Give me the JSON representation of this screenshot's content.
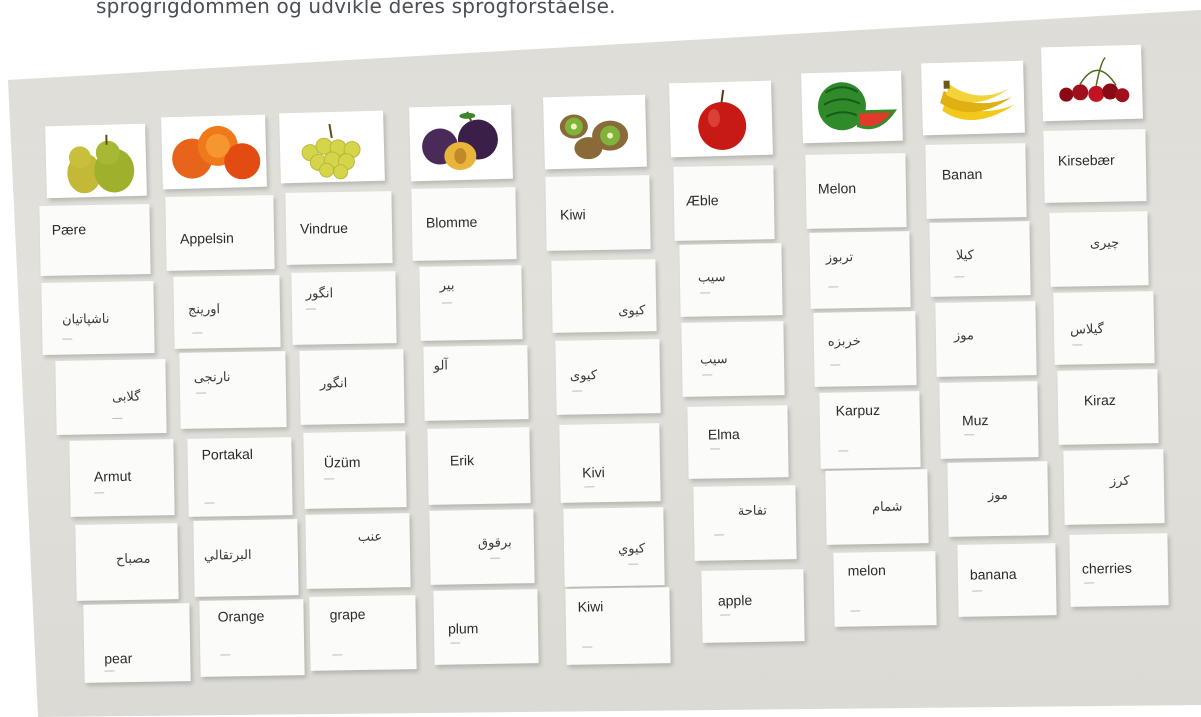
{
  "caption": "sprogrigdommen og udvikle deres sprogforståelse.",
  "fruits": [
    {
      "id": "pear",
      "danish": "Pære",
      "farsi": "ناشپاتیان",
      "arabic1": "گلابی",
      "turkish": "Armut",
      "arabic2": "مصباح",
      "english": "pear",
      "fruit_colors": [
        "#c9c03a",
        "#8a9b2a"
      ]
    },
    {
      "id": "orange",
      "danish": "Appelsin",
      "farsi": "اورينج",
      "arabic1": "نارنجی",
      "turkish": "Portakal",
      "arabic2": "البرتقالي",
      "english": "Orange",
      "fruit_colors": [
        "#f07a1a",
        "#e24b12"
      ]
    },
    {
      "id": "grape",
      "danish": "Vindrue",
      "farsi": "انگور",
      "arabic1": "انگور",
      "turkish": "Üzüm",
      "arabic2": "عنب",
      "english": "grape",
      "fruit_colors": [
        "#d6d44a",
        "#b9b93a"
      ]
    },
    {
      "id": "plum",
      "danish": "Blomme",
      "farsi": "بير",
      "arabic1": "آلو",
      "turkish": "Erik",
      "arabic2": "برقوق",
      "english": "plum",
      "fruit_colors": [
        "#4a2a58",
        "#e8b43a"
      ]
    },
    {
      "id": "kiwi",
      "danish": "Kiwi",
      "farsi": "كيوى",
      "arabic1": "كيوى",
      "turkish": "Kivi",
      "arabic2": "كيوي",
      "english": "Kiwi",
      "fruit_colors": [
        "#8b6a3a",
        "#7fb33a"
      ]
    },
    {
      "id": "apple",
      "danish": "Æble",
      "farsi": "سيب",
      "arabic1": "سيب",
      "turkish": "Elma",
      "arabic2": "تفاحة",
      "english": "apple",
      "fruit_colors": [
        "#c81a14",
        "#a81210"
      ]
    },
    {
      "id": "melon",
      "danish": "Melon",
      "farsi": "تربوز",
      "arabic1": "خربزه",
      "turkish": "Karpuz",
      "arabic2": "شمام",
      "english": "melon",
      "fruit_colors": [
        "#2f8a2a",
        "#e23a2a"
      ]
    },
    {
      "id": "banana",
      "danish": "Banan",
      "farsi": "كيلا",
      "arabic1": "موز",
      "turkish": "Muz",
      "arabic2": "موز",
      "english": "banana",
      "fruit_colors": [
        "#f2c81a",
        "#e0b012"
      ]
    },
    {
      "id": "cherry",
      "danish": "Kirsebær",
      "farsi": "چيرى",
      "arabic1": "گيلاس",
      "turkish": "Kiraz",
      "arabic2": "كرز",
      "english": "cherries",
      "fruit_colors": [
        "#8a0a14",
        "#c21224"
      ]
    }
  ]
}
